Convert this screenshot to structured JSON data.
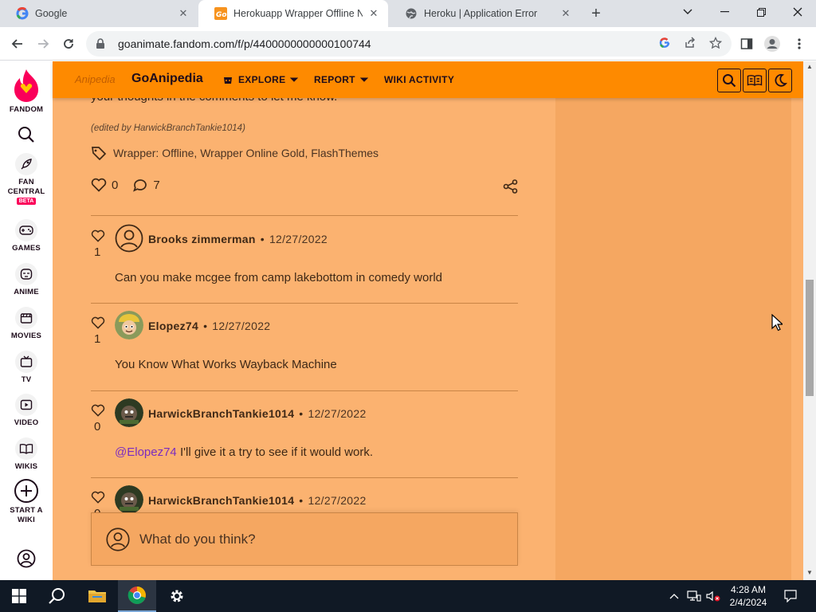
{
  "browser": {
    "tabs": [
      {
        "title": "Google"
      },
      {
        "title": "Herokuapp Wrapper Offline Not"
      },
      {
        "title": "Heroku | Application Error"
      }
    ],
    "url": "goanimate.fandom.com/f/p/4400000000000100744"
  },
  "rail": {
    "logo_label": "FANDOM",
    "items": [
      {
        "label": "FAN CENTRAL",
        "badge": "BETA"
      },
      {
        "label": "GAMES"
      },
      {
        "label": "ANIME"
      },
      {
        "label": "MOVIES"
      },
      {
        "label": "TV"
      },
      {
        "label": "VIDEO"
      },
      {
        "label": "WIKIS"
      },
      {
        "label": "START A WIKI"
      }
    ]
  },
  "community": {
    "wordmark": "Anipedia",
    "name": "GoAnipedia",
    "nav": [
      {
        "label": "EXPLORE"
      },
      {
        "label": "REPORT"
      },
      {
        "label": "WIKI ACTIVITY"
      }
    ]
  },
  "post": {
    "trailing_text": "your thoughts in the comments to let me know.",
    "edited_note": "(edited by HarwickBranchTankie1014)",
    "tags": "Wrapper: Offline, Wrapper Online Gold, FlashThemes",
    "likes": "0",
    "replies": "7"
  },
  "replies": [
    {
      "author": "Brooks zimmerman",
      "date": "12/27/2022",
      "likes": "1",
      "body": "Can you make mcgee from camp lakebottom in comedy world",
      "mention": ""
    },
    {
      "author": "Elopez74",
      "date": "12/27/2022",
      "likes": "1",
      "body": "You Know What Works Wayback Machine",
      "mention": ""
    },
    {
      "author": "HarwickBranchTankie1014",
      "date": "12/27/2022",
      "likes": "0",
      "body": " I'll give it a try to see if it would work.",
      "mention": "@Elopez74"
    },
    {
      "author": "HarwickBranchTankie1014",
      "date": "12/27/2022",
      "likes": "0",
      "body": "",
      "mention": ""
    }
  ],
  "compose": {
    "placeholder": "What do you think?"
  },
  "taskbar": {
    "time": "4:28 AM",
    "date": "2/4/2024"
  },
  "colors": {
    "page_bg": "#fbb270",
    "header": "#fe8a00",
    "text": "#3e2816",
    "mention": "#7b2cbf",
    "fandom_pink": "#fa005a"
  }
}
